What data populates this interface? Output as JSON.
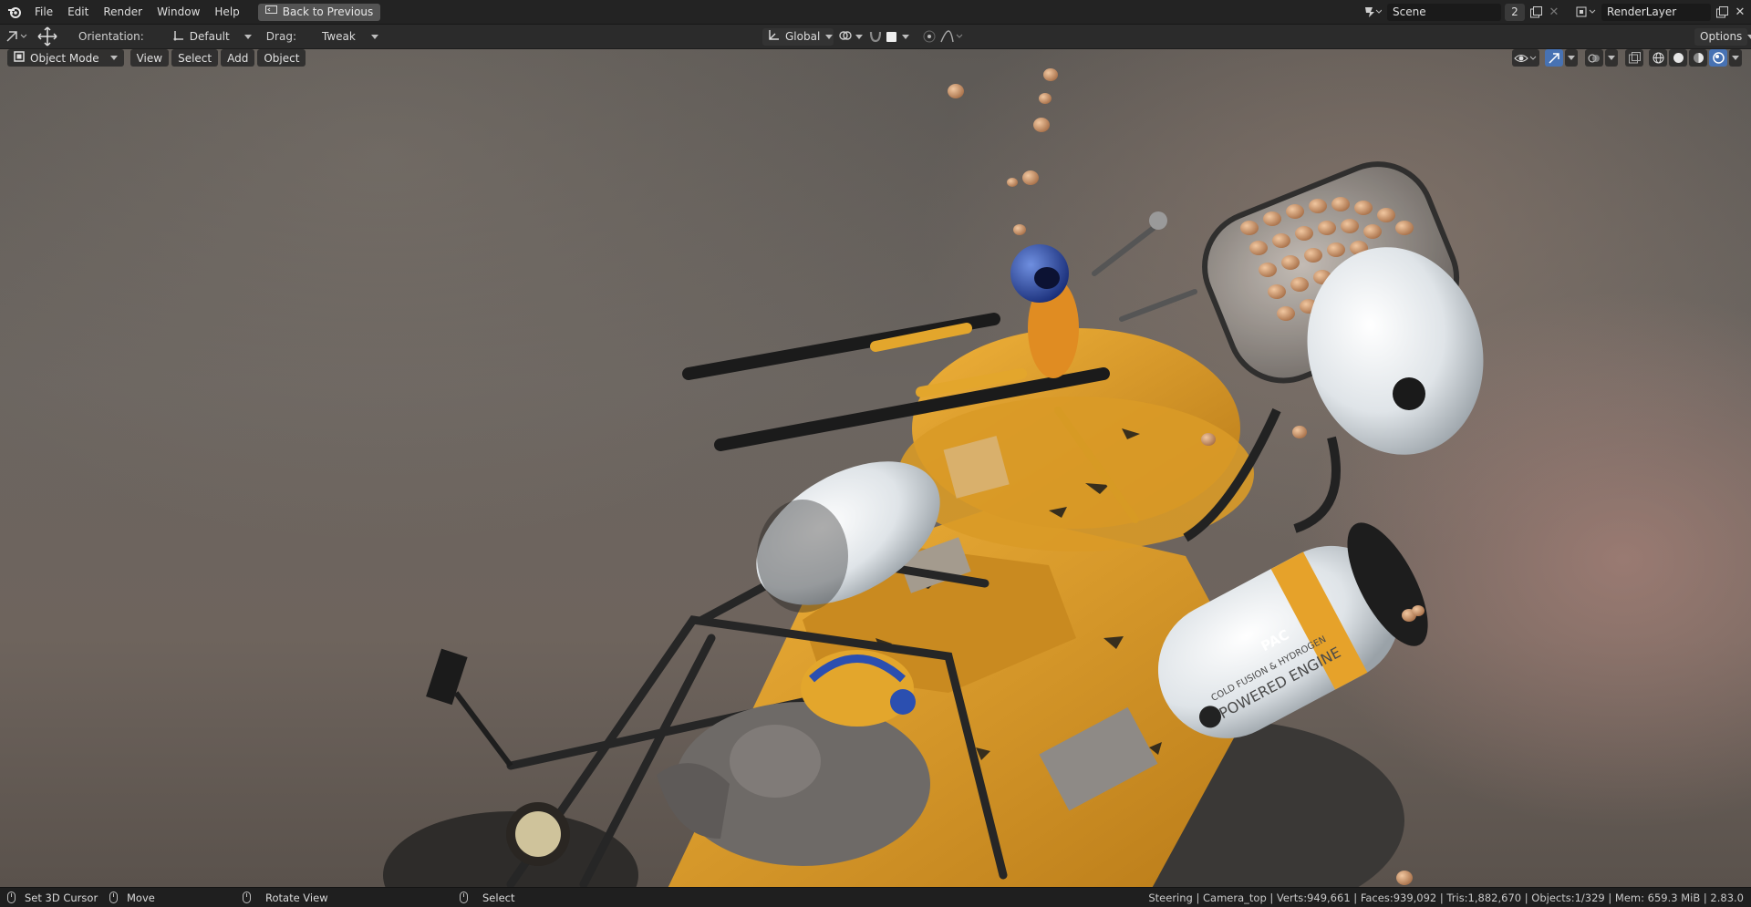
{
  "topbar": {
    "menus": [
      "File",
      "Edit",
      "Render",
      "Window",
      "Help"
    ],
    "back_button": "Back to Previous",
    "scene_name": "Scene",
    "scene_users": "2",
    "render_layer": "RenderLayer"
  },
  "tool_header": {
    "orientation_label": "Orientation:",
    "orientation_value": "Default",
    "drag_label": "Drag:",
    "drag_value": "Tweak",
    "transform_orientation": "Global",
    "options_label": "Options"
  },
  "viewport_header": {
    "mode": "Object Mode",
    "menus": [
      "View",
      "Select",
      "Add",
      "Object"
    ]
  },
  "render_text": {
    "tank_brand": "PAC",
    "tank_line1": "COLD FUSION & HYDROGEN",
    "tank_line2": "POWERED ENGINE"
  },
  "statusbar": {
    "items": [
      {
        "label": "Set 3D Cursor"
      },
      {
        "label": "Move"
      },
      {
        "label": "Rotate View"
      },
      {
        "label": "Select"
      }
    ],
    "stats": "Steering | Camera_top | Verts:949,661 | Faces:939,092 | Tris:1,882,670 | Objects:1/329 | Mem: 659.3 MiB | 2.83.0"
  },
  "colors": {
    "vehicle_yellow": "#e3a32a",
    "tank_white": "#e8ecef",
    "helmet_blue": "#2b4fb0",
    "accent_blue": "#4772b3"
  },
  "icons": [
    "blender-logo-icon",
    "back-screen-icon",
    "move-tool-icon",
    "orientation-icon",
    "transform-global-icon",
    "pivot-icon",
    "snap-icon",
    "proportional-icon",
    "visibility-icon",
    "gizmo-icon",
    "overlay-icon",
    "xray-icon",
    "wireframe-shading-icon",
    "solid-shading-icon",
    "material-shading-icon",
    "rendered-shading-icon",
    "mouse-icon"
  ]
}
